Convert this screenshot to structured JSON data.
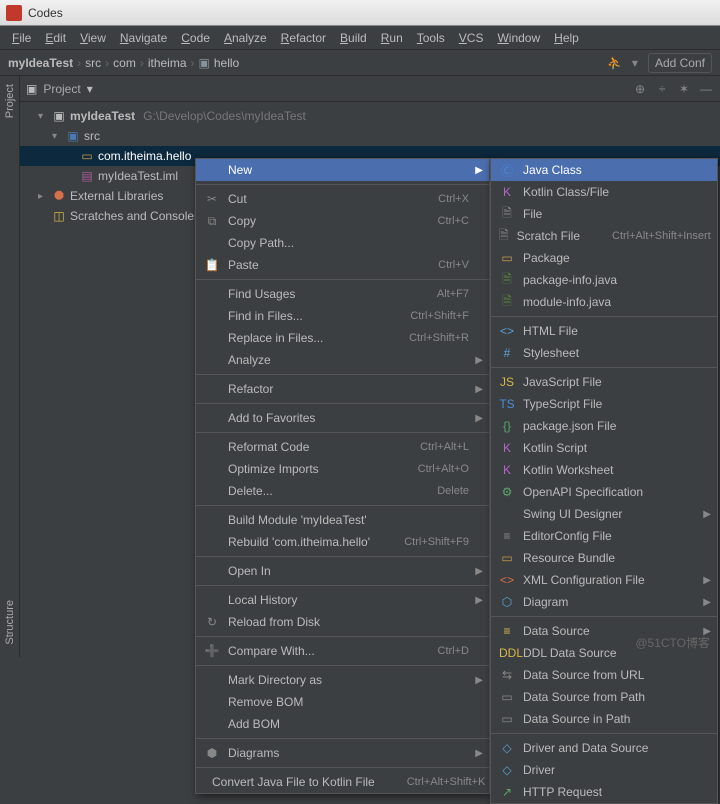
{
  "window": {
    "title": "Codes"
  },
  "menubar": [
    "File",
    "Edit",
    "View",
    "Navigate",
    "Code",
    "Analyze",
    "Refactor",
    "Build",
    "Run",
    "Tools",
    "VCS",
    "Window",
    "Help"
  ],
  "breadcrumb": {
    "project": "myIdeaTest",
    "parts": [
      "src",
      "com",
      "itheima",
      "hello"
    ],
    "addconf": "Add Conf"
  },
  "panel": {
    "title": "Project",
    "tools": [
      "⊕",
      "÷",
      "✶",
      "—"
    ]
  },
  "sidebar": {
    "tabs": [
      "Project",
      "Structure"
    ]
  },
  "tree": {
    "root": {
      "name": "myIdeaTest",
      "path": "G:\\Develop\\Codes\\myIdeaTest"
    },
    "src": "src",
    "pkg": "com.itheima.hello",
    "iml": "myIdeaTest.iml",
    "ext": "External Libraries",
    "scratch": "Scratches and Consoles"
  },
  "ctx": {
    "items": [
      {
        "icon": "",
        "label": "New",
        "sc": "",
        "arrow": true,
        "hi": true
      },
      {
        "sep": true
      },
      {
        "icon": "✂",
        "label": "Cut",
        "sc": "Ctrl+X"
      },
      {
        "icon": "⧉",
        "label": "Copy",
        "sc": "Ctrl+C"
      },
      {
        "icon": "",
        "label": "Copy Path...",
        "sc": ""
      },
      {
        "icon": "📋",
        "label": "Paste",
        "sc": "Ctrl+V"
      },
      {
        "sep": true
      },
      {
        "icon": "",
        "label": "Find Usages",
        "sc": "Alt+F7"
      },
      {
        "icon": "",
        "label": "Find in Files...",
        "sc": "Ctrl+Shift+F"
      },
      {
        "icon": "",
        "label": "Replace in Files...",
        "sc": "Ctrl+Shift+R"
      },
      {
        "icon": "",
        "label": "Analyze",
        "sc": "",
        "arrow": true
      },
      {
        "sep": true
      },
      {
        "icon": "",
        "label": "Refactor",
        "sc": "",
        "arrow": true
      },
      {
        "sep": true
      },
      {
        "icon": "",
        "label": "Add to Favorites",
        "sc": "",
        "arrow": true
      },
      {
        "sep": true
      },
      {
        "icon": "",
        "label": "Reformat Code",
        "sc": "Ctrl+Alt+L"
      },
      {
        "icon": "",
        "label": "Optimize Imports",
        "sc": "Ctrl+Alt+O"
      },
      {
        "icon": "",
        "label": "Delete...",
        "sc": "Delete"
      },
      {
        "sep": true
      },
      {
        "icon": "",
        "label": "Build Module 'myIdeaTest'",
        "sc": ""
      },
      {
        "icon": "",
        "label": "Rebuild 'com.itheima.hello'",
        "sc": "Ctrl+Shift+F9"
      },
      {
        "sep": true
      },
      {
        "icon": "",
        "label": "Open In",
        "sc": "",
        "arrow": true
      },
      {
        "sep": true
      },
      {
        "icon": "",
        "label": "Local History",
        "sc": "",
        "arrow": true
      },
      {
        "icon": "↻",
        "label": "Reload from Disk",
        "sc": ""
      },
      {
        "sep": true
      },
      {
        "icon": "➕",
        "label": "Compare With...",
        "sc": "Ctrl+D"
      },
      {
        "sep": true
      },
      {
        "icon": "",
        "label": "Mark Directory as",
        "sc": "",
        "arrow": true
      },
      {
        "icon": "",
        "label": "Remove BOM",
        "sc": ""
      },
      {
        "icon": "",
        "label": "Add BOM",
        "sc": ""
      },
      {
        "sep": true
      },
      {
        "icon": "⬢",
        "label": "Diagrams",
        "sc": "",
        "arrow": true
      },
      {
        "sep": true
      },
      {
        "icon": "",
        "label": "Convert Java File to Kotlin File",
        "sc": "Ctrl+Alt+Shift+K"
      }
    ]
  },
  "sub": {
    "items": [
      {
        "icon": "Ⓒ",
        "color": "#4b88d6",
        "label": "Java Class",
        "sc": "",
        "hi": true
      },
      {
        "icon": "K",
        "color": "#b066cc",
        "label": "Kotlin Class/File"
      },
      {
        "icon": "🗎",
        "color": "#888",
        "label": "File"
      },
      {
        "icon": "🗎",
        "color": "#888",
        "label": "Scratch File",
        "sc": "Ctrl+Alt+Shift+Insert"
      },
      {
        "icon": "▭",
        "color": "#c79a4a",
        "label": "Package"
      },
      {
        "icon": "🗎",
        "color": "#5a8a3a",
        "label": "package-info.java"
      },
      {
        "icon": "🗎",
        "color": "#5a8a3a",
        "label": "module-info.java"
      },
      {
        "sep": true
      },
      {
        "icon": "<>",
        "color": "#5aa0d6",
        "label": "HTML File"
      },
      {
        "icon": "#",
        "color": "#5aa0d6",
        "label": "Stylesheet"
      },
      {
        "sep": true
      },
      {
        "icon": "JS",
        "color": "#d6b84a",
        "label": "JavaScript File"
      },
      {
        "icon": "TS",
        "color": "#4a8fd6",
        "label": "TypeScript File"
      },
      {
        "icon": "{}",
        "color": "#5aa86a",
        "label": "package.json File"
      },
      {
        "icon": "K",
        "color": "#b066cc",
        "label": "Kotlin Script"
      },
      {
        "icon": "K",
        "color": "#b066cc",
        "label": "Kotlin Worksheet"
      },
      {
        "icon": "⚙",
        "color": "#5aa86a",
        "label": "OpenAPI Specification"
      },
      {
        "icon": "",
        "label": "Swing UI Designer",
        "arrow": true
      },
      {
        "icon": "≡",
        "color": "#888",
        "label": "EditorConfig File"
      },
      {
        "icon": "▭",
        "color": "#c79a4a",
        "label": "Resource Bundle"
      },
      {
        "icon": "<>",
        "color": "#d6704a",
        "label": "XML Configuration File",
        "arrow": true
      },
      {
        "icon": "⬡",
        "color": "#5aa0d6",
        "label": "Diagram",
        "arrow": true
      },
      {
        "sep": true
      },
      {
        "icon": "≡",
        "color": "#d6b84a",
        "label": "Data Source",
        "arrow": true
      },
      {
        "icon": "DDL",
        "color": "#d6b84a",
        "label": "DDL Data Source"
      },
      {
        "icon": "⇆",
        "color": "#888",
        "label": "Data Source from URL"
      },
      {
        "icon": "▭",
        "color": "#888",
        "label": "Data Source from Path"
      },
      {
        "icon": "▭",
        "color": "#888",
        "label": "Data Source in Path"
      },
      {
        "sep": true
      },
      {
        "icon": "◇",
        "color": "#5aa0d6",
        "label": "Driver and Data Source"
      },
      {
        "icon": "◇",
        "color": "#5aa0d6",
        "label": "Driver"
      },
      {
        "icon": "↗",
        "color": "#5aa86a",
        "label": "HTTP Request"
      }
    ]
  },
  "watermark": "@51CTO博客"
}
